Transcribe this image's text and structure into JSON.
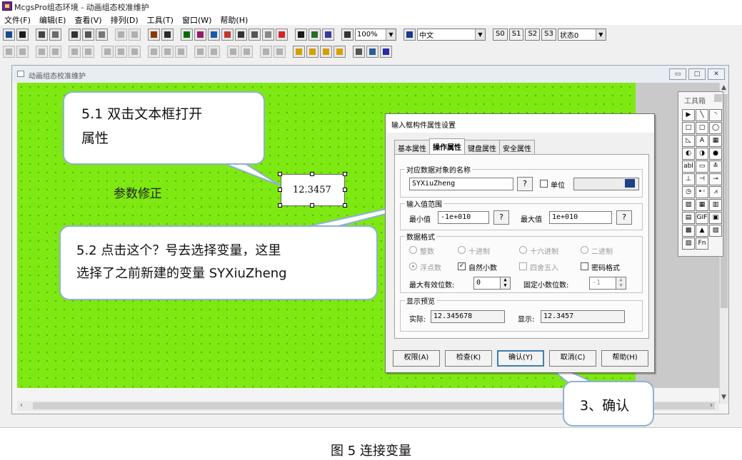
{
  "app": {
    "title": "McgsPro组态环境 - 动画组态校准维护"
  },
  "menu": [
    "文件(F)",
    "编辑(E)",
    "查看(V)",
    "排列(D)",
    "工具(T)",
    "窗口(W)",
    "帮助(H)"
  ],
  "toolbar": {
    "zoom": "100%",
    "language": "中文",
    "state_buttons": [
      "S0",
      "S1",
      "S2",
      "S3"
    ],
    "state_combo": "状态0"
  },
  "child_window": {
    "title": "动画组态校准维护"
  },
  "canvas": {
    "param_label": "参数修正",
    "textbox_value": "12.3457"
  },
  "toolbox": {
    "title": "工具箱",
    "tools": [
      "▶",
      "╲",
      "◝",
      "□",
      "▢",
      "◯",
      "◺",
      "A",
      "▦",
      "◐",
      "◑",
      "●",
      "abl",
      "▭",
      "≛",
      "⊥",
      "⊣",
      "⊸",
      "◷",
      "•◦",
      "⩘",
      "▨",
      "▦",
      "▥",
      "▤",
      "GIF",
      "▣",
      "▩",
      "▲",
      "▧",
      "▨",
      "Fn"
    ]
  },
  "dialog": {
    "title": "输入框构件属性设置",
    "tabs": [
      "基本属性",
      "操作属性",
      "键盘属性",
      "安全属性"
    ],
    "active_tab": "操作属性",
    "group_binding": {
      "title": "对应数据对象的名称",
      "value": "SYXiuZheng",
      "q_button": "?",
      "unit_label": "单位"
    },
    "group_range": {
      "title": "输入值范围",
      "min_label": "最小值",
      "min_value": "-1e+010",
      "max_label": "最大值",
      "max_value": "1e+010",
      "q_button": "?"
    },
    "group_format": {
      "title": "数据格式",
      "options_row1": [
        "整数",
        "十进制",
        "十六进制",
        "二进制"
      ],
      "float_label": "浮点数",
      "natural_decimal_label": "自然小数",
      "natural_decimal_checked": true,
      "round_label": "四舍五入",
      "password_label": "密码格式",
      "max_digits_label": "最大有效位数:",
      "max_digits_value": "0",
      "fixed_decimal_label": "固定小数位数:",
      "fixed_decimal_value": "-1"
    },
    "group_preview": {
      "title": "显示预览",
      "actual_label": "实际:",
      "actual_value": "12.345678",
      "display_label": "显示:",
      "display_value": "12.3457"
    },
    "buttons": [
      "权限(A)",
      "检查(K)",
      "确认(Y)",
      "取消(C)",
      "帮助(H)"
    ]
  },
  "callouts": {
    "c1": [
      "5.1  双击文本框打开",
      "属性"
    ],
    "c2": [
      "5.2 点击这个？号去选择变量，这里",
      "选择了之前新建的变量 SYXiuZheng"
    ],
    "c3": "3、确认"
  },
  "caption": "图 5 连接变量"
}
